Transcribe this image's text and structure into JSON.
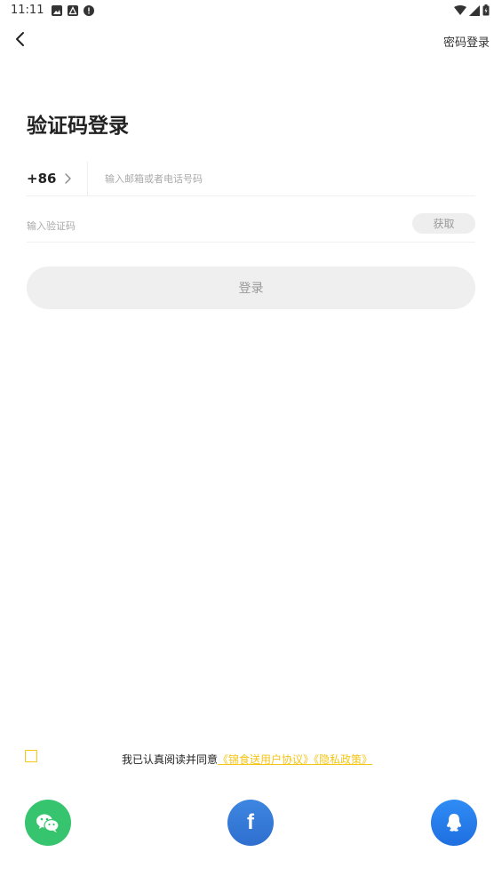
{
  "status_bar": {
    "time": "11:11"
  },
  "nav": {
    "password_login": "密码登录"
  },
  "title": "验证码登录",
  "phone": {
    "country_code": "+86",
    "placeholder": "输入邮箱或者电话号码"
  },
  "code": {
    "placeholder": "输入验证码",
    "get_label": "获取"
  },
  "login": {
    "label": "登录"
  },
  "agreement": {
    "text": "我已认真阅读并同意",
    "link_user": "《锦食送用户协议》",
    "link_privacy": "《隐私政策》"
  },
  "social": {
    "icons": [
      "wechat-icon",
      "facebook-icon",
      "qq-icon"
    ]
  },
  "colors": {
    "accent": "#f5c518",
    "wechat": "#36c46e",
    "facebook": "#3d86e0",
    "qq": "#2f8cf5",
    "button_bg": "#efefef",
    "button_text": "#999999"
  }
}
